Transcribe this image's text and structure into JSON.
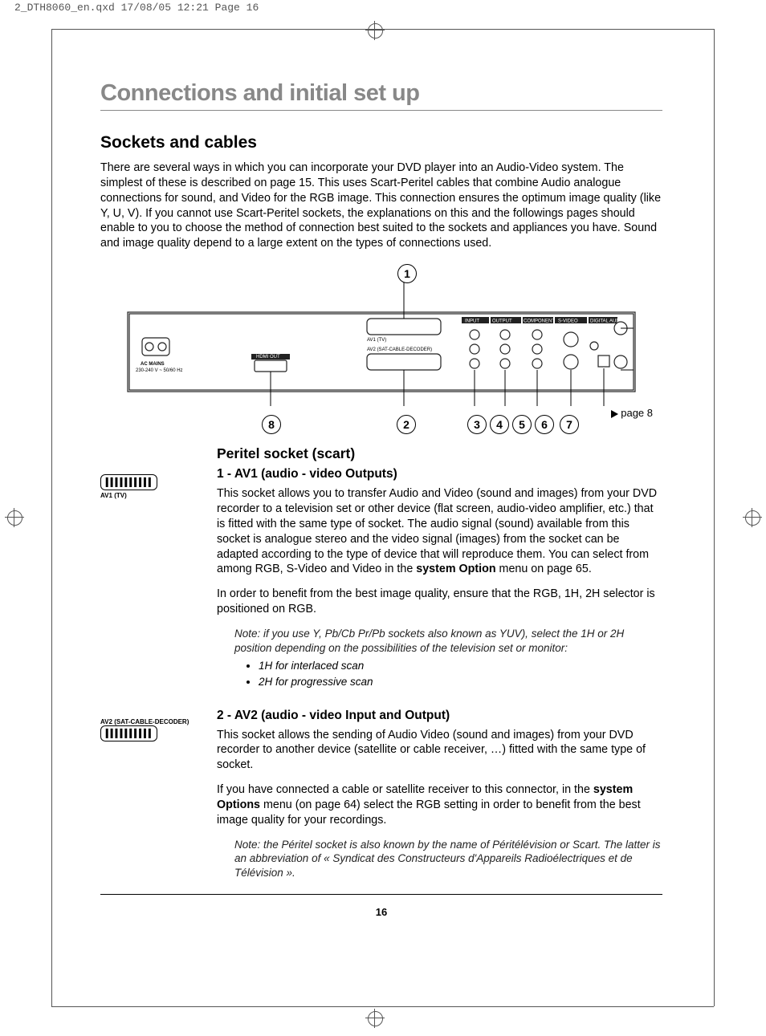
{
  "meta": {
    "header_text": "2_DTH8060_en.qxd  17/08/05  12:21  Page 16"
  },
  "page": {
    "title": "Connections and initial set up",
    "section": "Sockets and cables",
    "intro": "There are several ways in which you can incorporate your DVD player into an Audio-Video system. The simplest of these is described on page 15. This uses Scart-Peritel cables that combine Audio analogue connections for sound, and Video for the RGB image. This connection ensures the optimum image quality (like Y, U, V). If you cannot use Scart-Peritel sockets, the explanations on this and the followings pages should enable to you to choose the method of connection best suited to the sockets and appliances you have. Sound and image quality depend to a large extent on the types of connections used.",
    "diagram_ref": "page 8",
    "callouts": [
      "1",
      "2",
      "3",
      "4",
      "5",
      "6",
      "7",
      "8"
    ],
    "peritel_heading": "Peritel socket (scart)",
    "av1": {
      "heading": "1 - AV1 (audio - video Outputs)",
      "icon_label": "AV1 (TV)",
      "p1a": "This socket allows you to transfer Audio and Video (sound and images) from your DVD recorder to a television set or other device (flat screen, audio-video amplifier, etc.) that is fitted with the same type of socket. The audio signal (sound) available from this socket is analogue stereo and the video signal (images) from the socket can be adapted according to the type of device that will reproduce them. You can select from among RGB, S-Video and Video in the ",
      "p1_bold": "system Option",
      "p1b": " menu on page 65.",
      "p2": "In order to benefit from the best image quality, ensure that the RGB, 1H, 2H selector is positioned on RGB.",
      "note": "Note: if you use Y, Pb/Cb Pr/Pb sockets also known as YUV), select the 1H or 2H position depending on the possibilities of the television set or monitor:",
      "b1": "1H for interlaced scan",
      "b2": "2H for progressive scan"
    },
    "av2": {
      "heading": "2 - AV2 (audio - video Input and Output)",
      "icon_label": "AV2 (SAT-CABLE-DECODER)",
      "p1": "This socket allows the sending of Audio Video (sound and images) from your DVD recorder to another device (satellite or cable receiver, …) fitted with the same type of socket.",
      "p2a": "If you have connected a cable or satellite receiver to this connector, in the ",
      "p2_bold": "system Options",
      "p2b": " menu (on page 64) select the RGB setting in order to benefit from the best image quality for your recordings.",
      "note": "Note: the Péritel socket is also known by the name of Péritélévision or Scart. The latter is an abbreviation of « Syndicat des Constructeurs d'Appareils Radioélectriques et de Télévision »."
    },
    "page_number": "16"
  }
}
